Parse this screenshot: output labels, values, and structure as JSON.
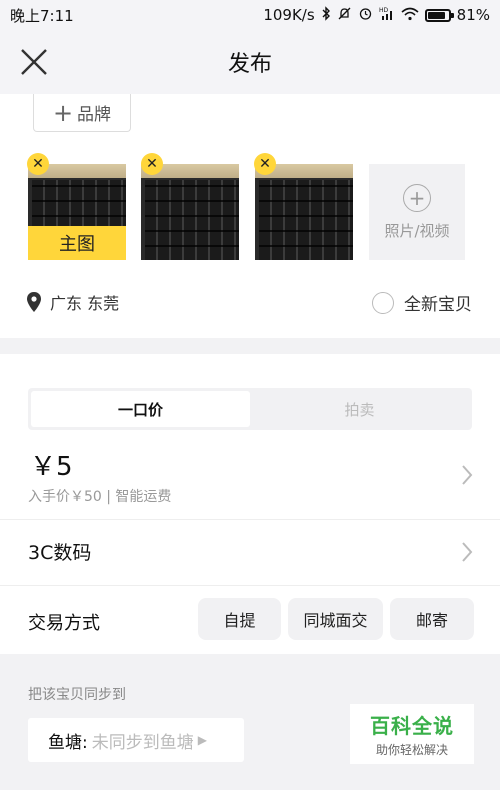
{
  "status_bar": {
    "time": "晚上7:11",
    "network_speed": "109K/s",
    "battery": "81%",
    "battery_level": 0.81,
    "icons": [
      "bluetooth-icon",
      "mute-icon",
      "alarm-icon",
      "hd-signal-icon",
      "wifi-icon",
      "battery-icon"
    ]
  },
  "nav": {
    "title": "发布",
    "close_icon": "close-icon"
  },
  "brand": {
    "label": "品牌"
  },
  "photos": {
    "main_label": "主图",
    "add_label": "照片/视频"
  },
  "location": {
    "text": "广东 东莞"
  },
  "new_item": {
    "label": "全新宝贝",
    "checked": false
  },
  "pricing": {
    "tabs": [
      {
        "label": "一口价",
        "active": true
      },
      {
        "label": "拍卖",
        "active": false
      }
    ],
    "price": "￥5",
    "sub": "入手价￥50 | 智能运费"
  },
  "category": {
    "label": "3C数码"
  },
  "trade": {
    "label": "交易方式",
    "options": [
      "自提",
      "同城面交",
      "邮寄"
    ]
  },
  "sync": {
    "label": "把该宝贝同步到",
    "pond_key": "鱼塘:",
    "pond_value": "未同步到鱼塘"
  },
  "watermark": {
    "title": "百科全说",
    "subtitle": "助你轻松解决"
  },
  "colors": {
    "accent": "#ffd63a",
    "watermark_green": "#3ab04a"
  }
}
